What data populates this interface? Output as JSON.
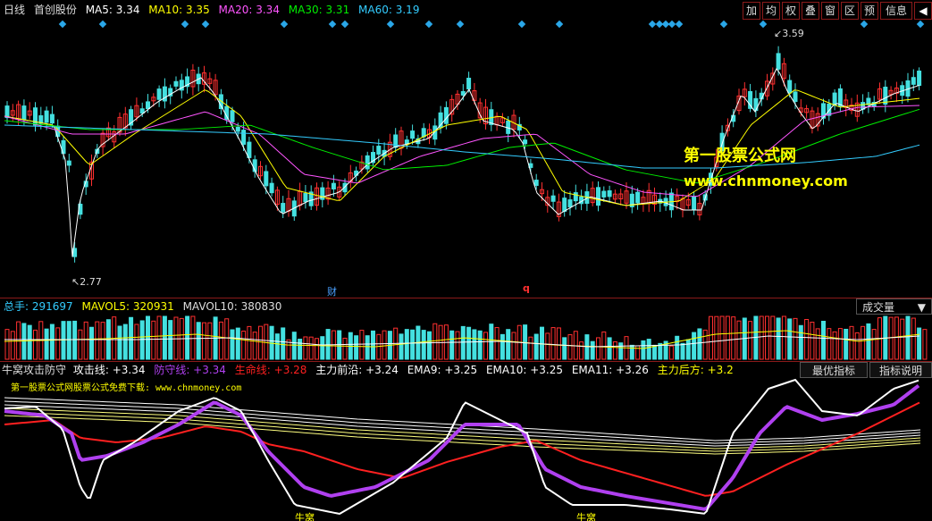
{
  "main": {
    "period": "日线",
    "stock": "首创股份",
    "ma": [
      {
        "label": "MA5: 3.34",
        "color": "#ffffff"
      },
      {
        "label": "MA10: 3.35",
        "color": "#ffff00"
      },
      {
        "label": "MA20: 3.34",
        "color": "#ff55ff"
      },
      {
        "label": "MA30: 3.31",
        "color": "#00ee00"
      },
      {
        "label": "MA60: 3.19",
        "color": "#33ccff"
      }
    ],
    "buttons": [
      "加",
      "均",
      "权",
      "叠",
      "窗",
      "区",
      "预",
      "信息"
    ],
    "high_label": "3.59",
    "low_label": "2.77",
    "marker_cai": "财",
    "marker_q": "q"
  },
  "watermark": {
    "line1": "第一股票公式网",
    "line2": "www.chnmoney.com"
  },
  "volume": {
    "total": "总手: 291697",
    "mavol5": "MAVOL5: 320931",
    "mavol10": "MAVOL10: 380830",
    "dropdown": "成交量"
  },
  "indicator": {
    "title": "牛窝攻击防守",
    "items": [
      {
        "label": "攻击线: +3.34",
        "color": "#ffffff"
      },
      {
        "label": "防守线: +3.34",
        "color": "#b040f0"
      },
      {
        "label": "生命线: +3.28",
        "color": "#ff2020"
      },
      {
        "label": "主力前沿: +3.24",
        "color": "#ffffff"
      },
      {
        "label": "EMA9: +3.25",
        "color": "#ffffff"
      },
      {
        "label": "EMA10: +3.25",
        "color": "#ffffff"
      },
      {
        "label": "EMA11: +3.26",
        "color": "#ffffff"
      },
      {
        "label": "主力后方: +3.2",
        "color": "#ffff00"
      }
    ],
    "btn_best": "最优指标",
    "btn_help": "指标说明",
    "download": "第一股票公式网股票公式免费下载: www.chnmoney.com",
    "niuwo1": "牛窝",
    "niuwo2": "牛窝"
  }
}
